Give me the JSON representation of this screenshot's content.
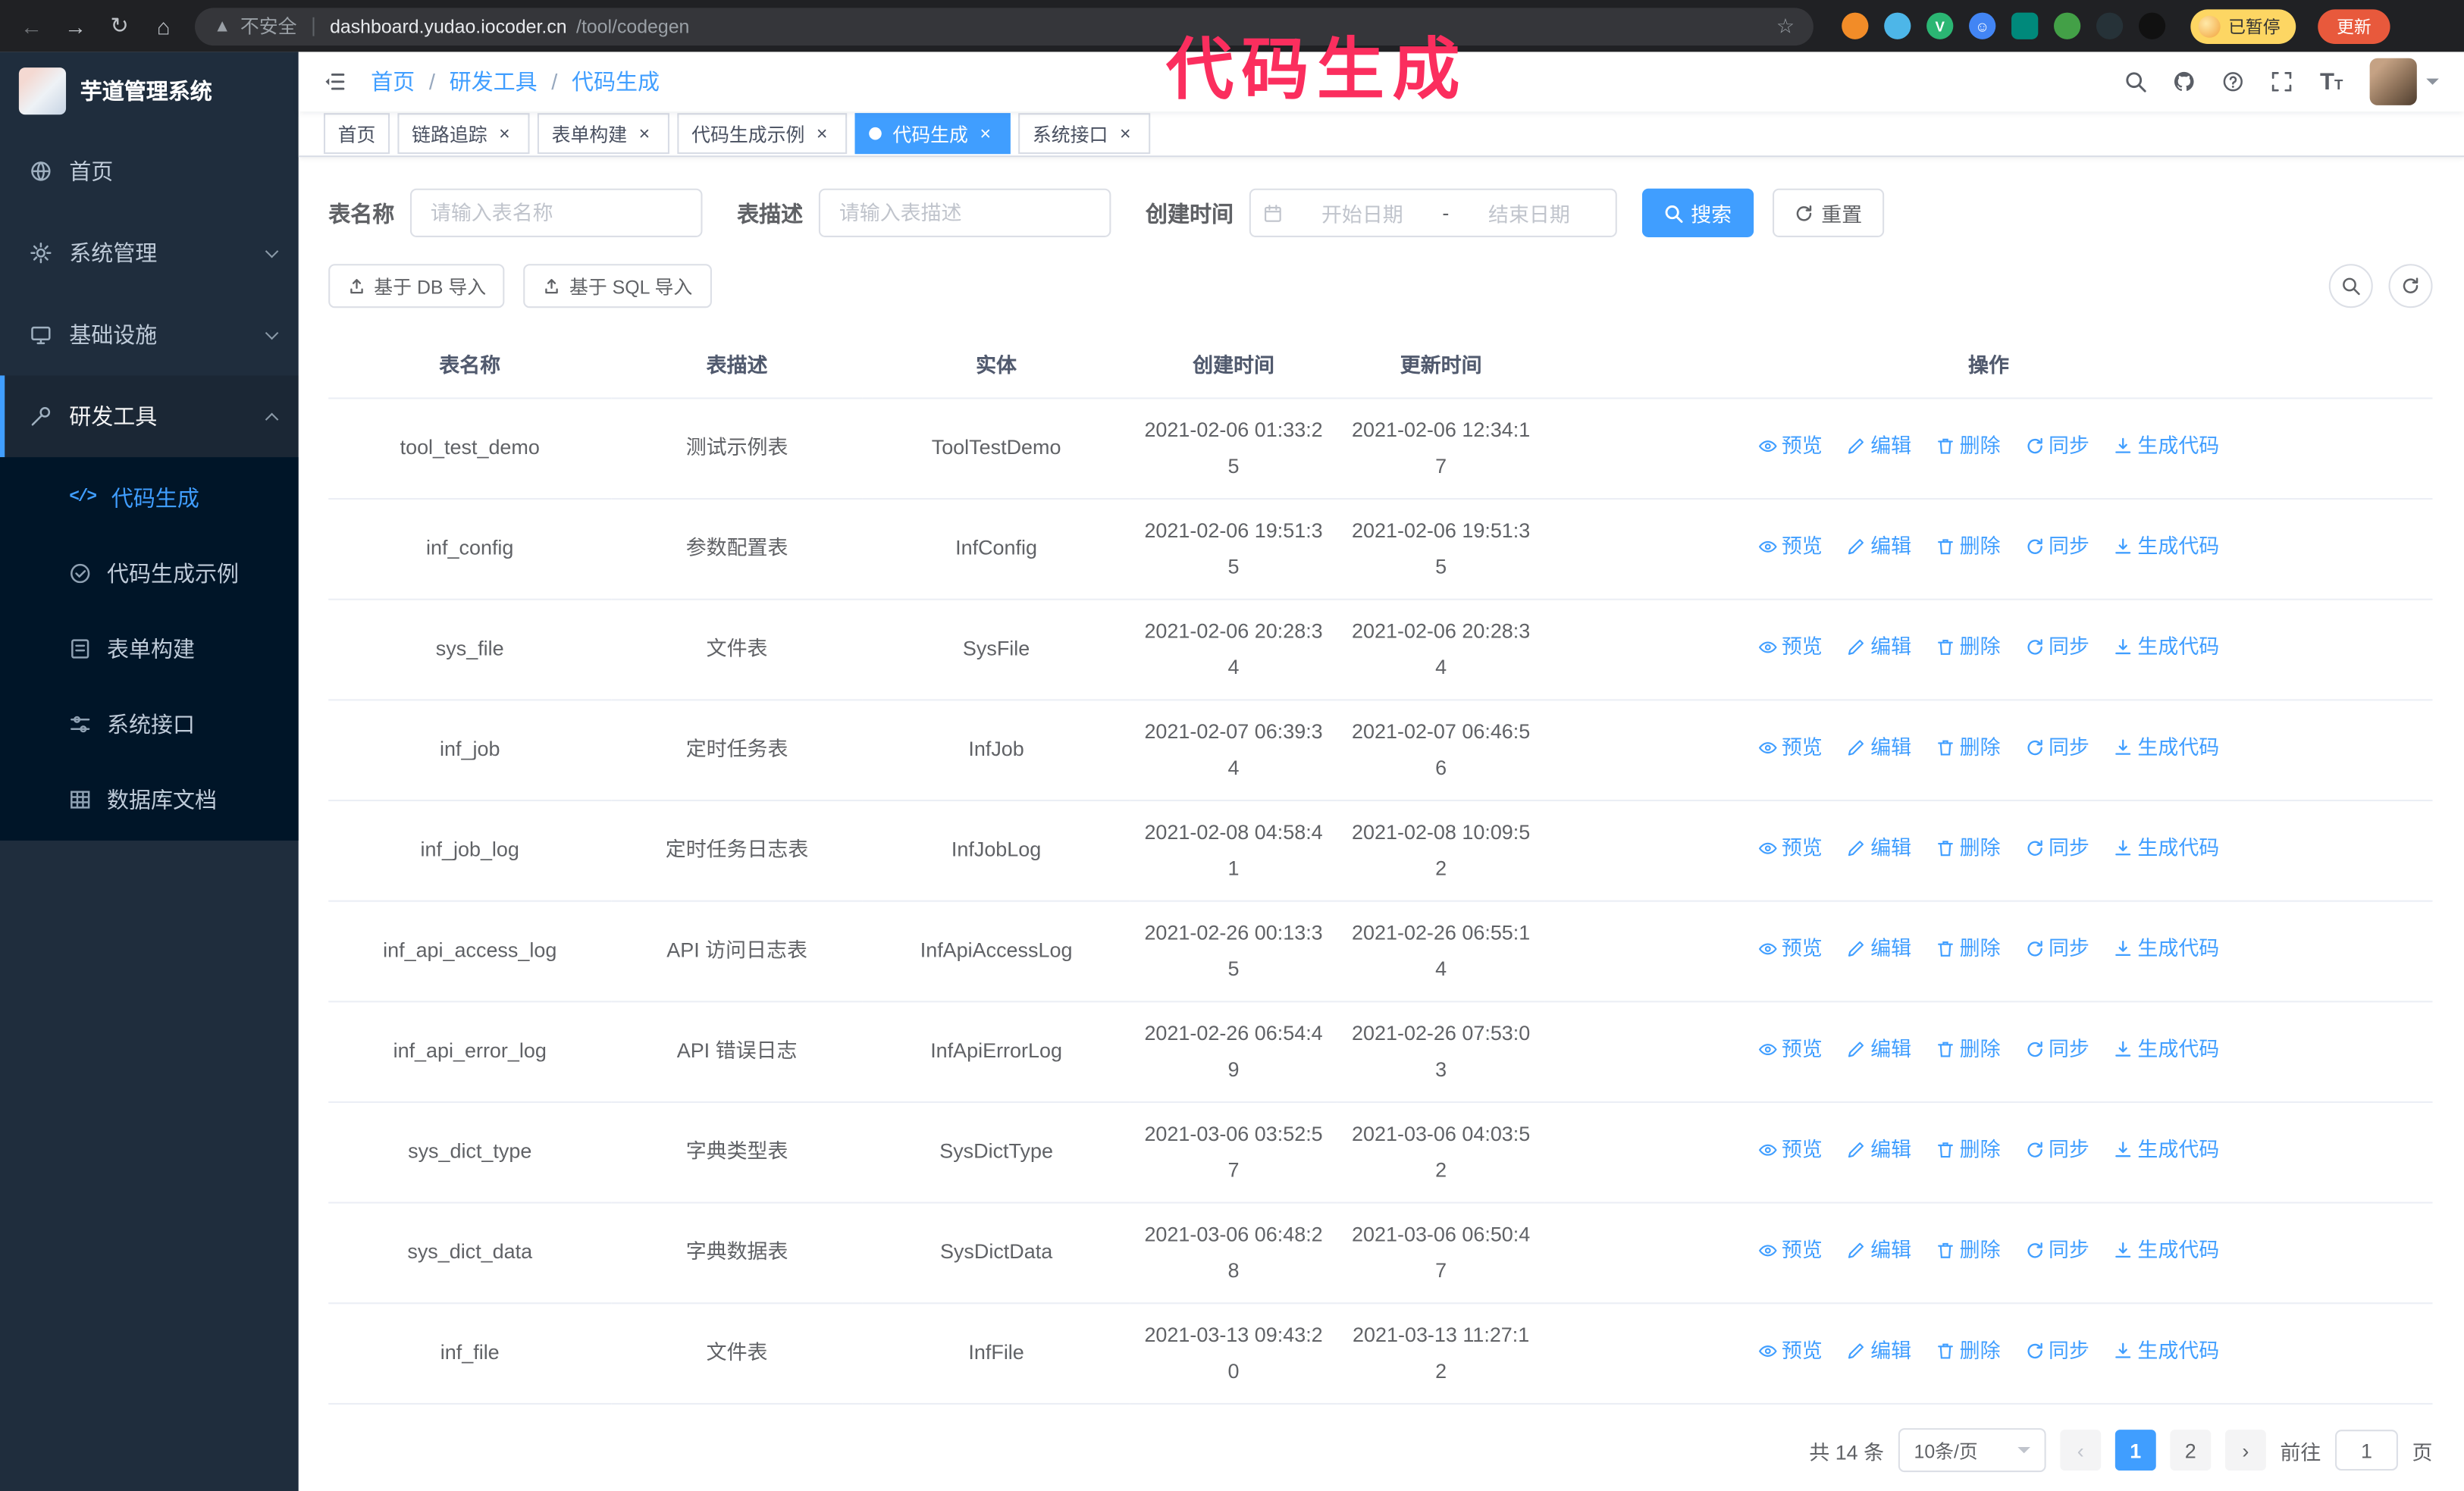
{
  "theme": {
    "accent": "#409eff"
  },
  "annotation": {
    "text": "代码生成",
    "color": "#fb2e5e"
  },
  "browser": {
    "security_warning": "不安全",
    "url_host": "dashboard.yudao.iocoder.cn",
    "url_path": "/tool/codegen",
    "paused_badge": "已暂停",
    "update_button": "更新"
  },
  "sidebar": {
    "logo_title": "芋道管理系统",
    "items": [
      {
        "label": "首页"
      },
      {
        "label": "系统管理"
      },
      {
        "label": "基础设施"
      },
      {
        "label": "研发工具"
      }
    ],
    "submenu": [
      {
        "label": "代码生成"
      },
      {
        "label": "代码生成示例"
      },
      {
        "label": "表单构建"
      },
      {
        "label": "系统接口"
      },
      {
        "label": "数据库文档"
      }
    ]
  },
  "breadcrumb": {
    "items": [
      "首页",
      "研发工具",
      "代码生成"
    ],
    "separator": "/"
  },
  "tabs": [
    {
      "label": "首页",
      "closable": false,
      "active": false
    },
    {
      "label": "链路追踪",
      "closable": true,
      "active": false
    },
    {
      "label": "表单构建",
      "closable": true,
      "active": false
    },
    {
      "label": "代码生成示例",
      "closable": true,
      "active": false
    },
    {
      "label": "代码生成",
      "closable": true,
      "active": true
    },
    {
      "label": "系统接口",
      "closable": true,
      "active": false
    }
  ],
  "filters": {
    "table_name_label": "表名称",
    "table_name_placeholder": "请输入表名称",
    "table_desc_label": "表描述",
    "table_desc_placeholder": "请输入表描述",
    "create_time_label": "创建时间",
    "date_start_placeholder": "开始日期",
    "date_separator": "-",
    "date_end_placeholder": "结束日期",
    "search_button": "搜索",
    "reset_button": "重置"
  },
  "toolbar": {
    "import_db": "基于 DB 导入",
    "import_sql": "基于 SQL 导入"
  },
  "table": {
    "columns": [
      "表名称",
      "表描述",
      "实体",
      "创建时间",
      "更新时间",
      "操作"
    ],
    "actions": [
      "预览",
      "编辑",
      "删除",
      "同步",
      "生成代码"
    ],
    "rows": [
      {
        "name": "tool_test_demo",
        "desc": "测试示例表",
        "entity": "ToolTestDemo",
        "created": "2021-02-06 01:33:25",
        "updated": "2021-02-06 12:34:17"
      },
      {
        "name": "inf_config",
        "desc": "参数配置表",
        "entity": "InfConfig",
        "created": "2021-02-06 19:51:35",
        "updated": "2021-02-06 19:51:35"
      },
      {
        "name": "sys_file",
        "desc": "文件表",
        "entity": "SysFile",
        "created": "2021-02-06 20:28:34",
        "updated": "2021-02-06 20:28:34"
      },
      {
        "name": "inf_job",
        "desc": "定时任务表",
        "entity": "InfJob",
        "created": "2021-02-07 06:39:34",
        "updated": "2021-02-07 06:46:56"
      },
      {
        "name": "inf_job_log",
        "desc": "定时任务日志表",
        "entity": "InfJobLog",
        "created": "2021-02-08 04:58:41",
        "updated": "2021-02-08 10:09:52"
      },
      {
        "name": "inf_api_access_log",
        "desc": "API 访问日志表",
        "entity": "InfApiAccessLog",
        "created": "2021-02-26 00:13:35",
        "updated": "2021-02-26 06:55:14"
      },
      {
        "name": "inf_api_error_log",
        "desc": "API 错误日志",
        "entity": "InfApiErrorLog",
        "created": "2021-02-26 06:54:49",
        "updated": "2021-02-26 07:53:03"
      },
      {
        "name": "sys_dict_type",
        "desc": "字典类型表",
        "entity": "SysDictType",
        "created": "2021-03-06 03:52:57",
        "updated": "2021-03-06 04:03:52"
      },
      {
        "name": "sys_dict_data",
        "desc": "字典数据表",
        "entity": "SysDictData",
        "created": "2021-03-06 06:48:28",
        "updated": "2021-03-06 06:50:47"
      },
      {
        "name": "inf_file",
        "desc": "文件表",
        "entity": "InfFile",
        "created": "2021-03-13 09:43:20",
        "updated": "2021-03-13 11:27:12"
      }
    ]
  },
  "pagination": {
    "total": "共 14 条",
    "page_size": "10条/页",
    "pages": [
      "1",
      "2"
    ],
    "goto_label": "前往",
    "goto_value": "1",
    "page_suffix": "页"
  }
}
